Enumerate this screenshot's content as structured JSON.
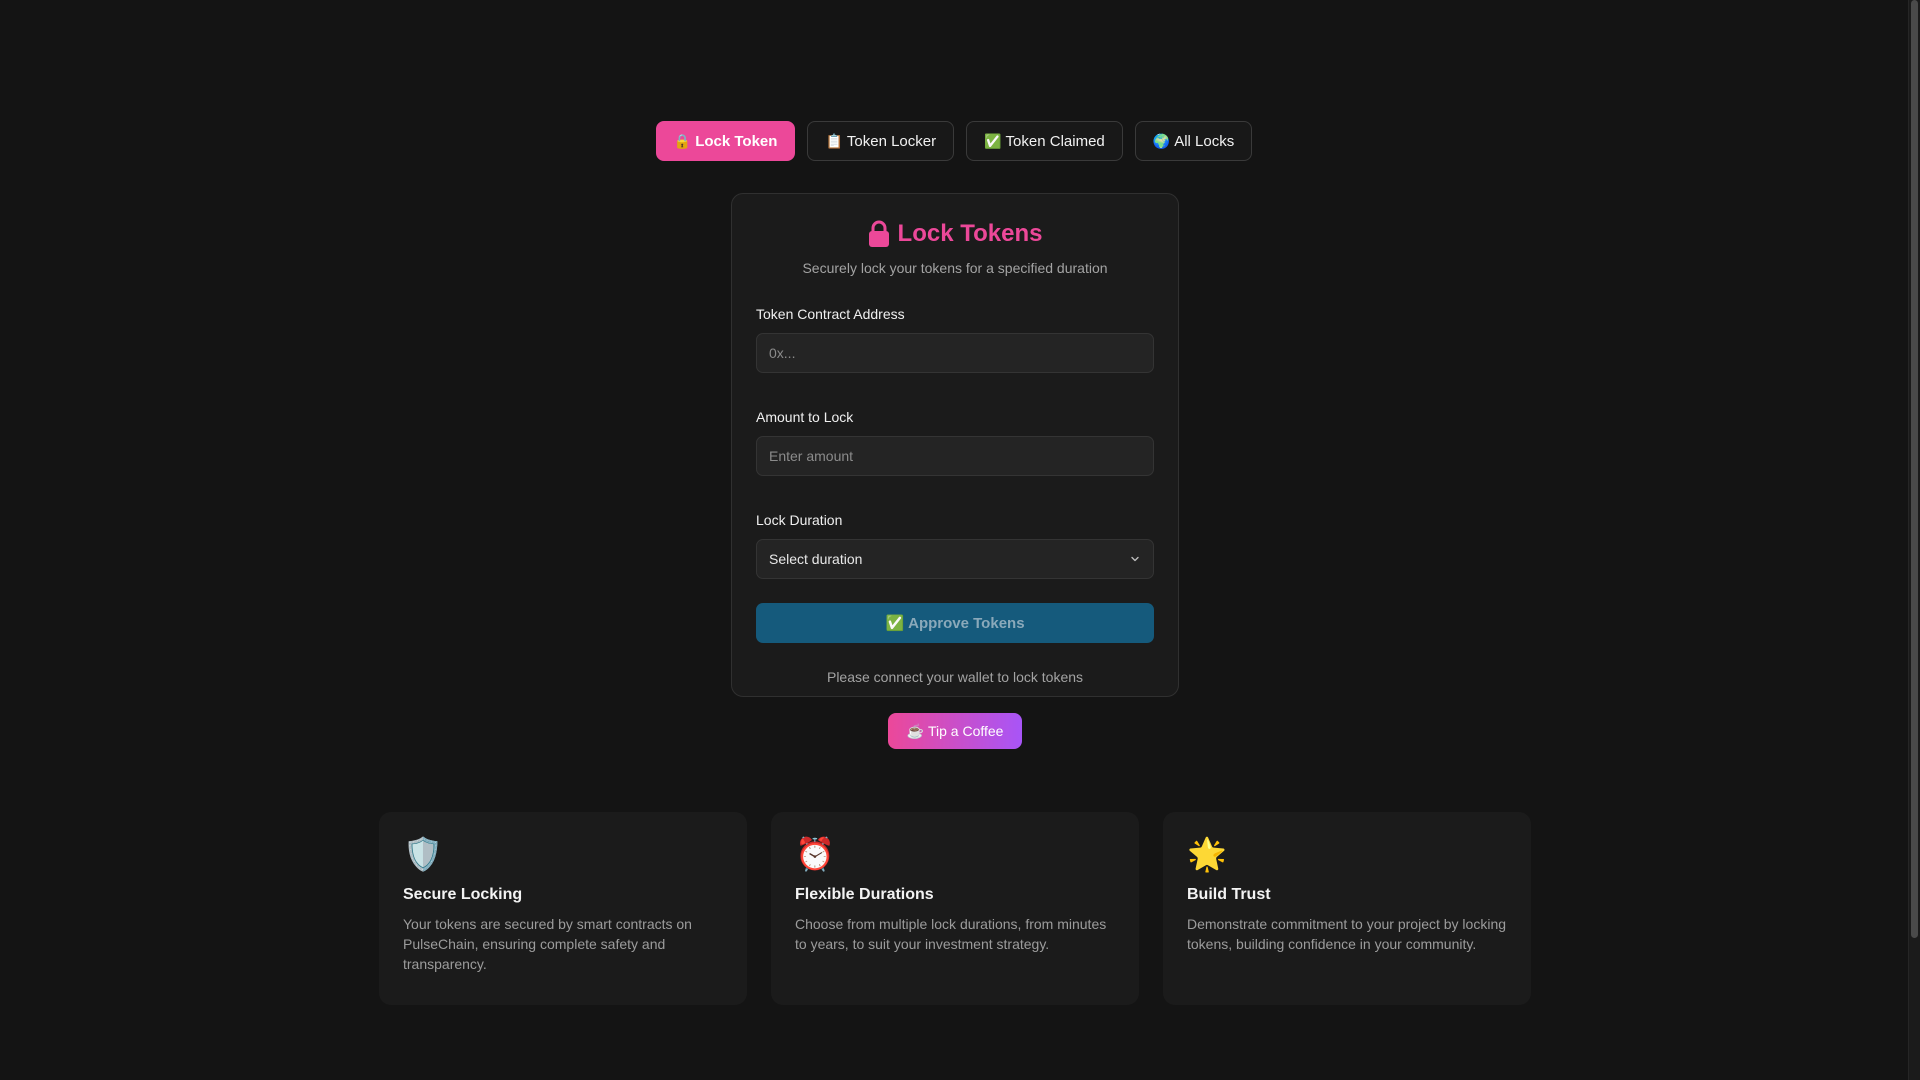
{
  "tabs": [
    {
      "icon": "🔒",
      "label": "Lock Token",
      "active": true
    },
    {
      "icon": "📋",
      "label": "Token Locker",
      "active": false
    },
    {
      "icon": "✅",
      "label": "Token Claimed",
      "active": false
    },
    {
      "icon": "🌍",
      "label": "All Locks",
      "active": false
    }
  ],
  "card": {
    "title": "Lock Tokens",
    "subtitle": "Securely lock your tokens for a specified duration",
    "address_label": "Token Contract Address",
    "address_placeholder": "0x...",
    "amount_label": "Amount to Lock",
    "amount_placeholder": "Enter amount",
    "duration_label": "Lock Duration",
    "duration_value": "Select duration",
    "approve_icon": "✅",
    "approve_label": "Approve Tokens",
    "wallet_message": "Please connect your wallet to lock tokens"
  },
  "tip": {
    "icon": "☕",
    "label": "Tip a Coffee"
  },
  "features": [
    {
      "icon": "🛡️",
      "title": "Secure Locking",
      "desc": "Your tokens are secured by smart contracts on PulseChain, ensuring complete safety and transparency."
    },
    {
      "icon": "⏰",
      "title": "Flexible Durations",
      "desc": "Choose from multiple lock durations, from minutes to years, to suit your investment strategy."
    },
    {
      "icon": "🌟",
      "title": "Build Trust",
      "desc": "Demonstrate commitment to your project by locking tokens, building confidence in your community."
    }
  ],
  "colors": {
    "background": "#141414",
    "accent_pink": "#ec4899",
    "accent_purple": "#a855f7",
    "approve_blue": "#155a7c"
  }
}
